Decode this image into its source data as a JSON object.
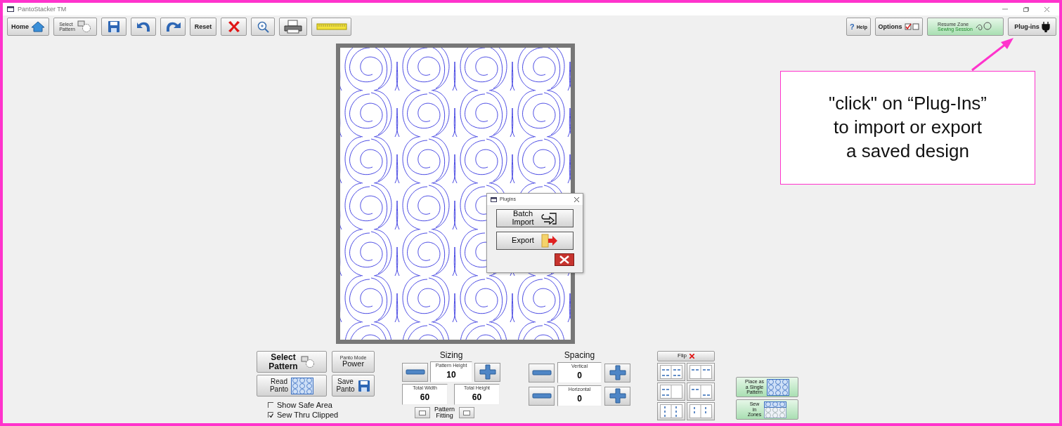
{
  "window": {
    "title": "PantoStacker TM"
  },
  "toolbar": [
    {
      "kind": "home",
      "label": "Home"
    },
    {
      "kind": "select",
      "lines": [
        "Select",
        "Pattern"
      ]
    },
    {
      "kind": "save"
    },
    {
      "kind": "undo"
    },
    {
      "kind": "redo"
    },
    {
      "kind": "reset",
      "label": "Reset"
    },
    {
      "kind": "delete"
    },
    {
      "kind": "zoom"
    },
    {
      "kind": "print"
    },
    {
      "kind": "ruler"
    }
  ],
  "toolbar_right": [
    {
      "kind": "help",
      "mark": "?",
      "label": "Help"
    },
    {
      "kind": "options",
      "label": "Options"
    },
    {
      "kind": "resume",
      "lines": [
        "Resume Zone",
        "Sewing Session"
      ]
    },
    {
      "kind": "plugins",
      "label": "Plug-ins"
    }
  ],
  "plugins_dialog": {
    "title": "Plugins",
    "buttons": [
      {
        "kind": "import",
        "lines": [
          "Batch",
          "Import"
        ]
      },
      {
        "kind": "export",
        "lines": [
          "Export"
        ]
      }
    ]
  },
  "mode_buttons": [
    {
      "kind": "select",
      "lines": [
        "Select",
        "Pattern"
      ]
    },
    {
      "kind": "mode",
      "caption": "Panto Mode",
      "lines": [
        "Power"
      ]
    },
    {
      "kind": "read",
      "lines": [
        "Read",
        "Panto"
      ]
    },
    {
      "kind": "save",
      "lines": [
        "Save",
        "Panto"
      ]
    }
  ],
  "checkboxes": [
    {
      "label": "Show Safe Area",
      "checked": false
    },
    {
      "label": "Sew Thru Clipped",
      "checked": true
    }
  ],
  "sizing": {
    "title": "Sizing",
    "pattern_height": {
      "label": "Pattern Height",
      "value": "10"
    },
    "total_width": {
      "label": "Total Width",
      "value": "60"
    },
    "total_height": {
      "label": "Total Height",
      "value": "60"
    },
    "fitting_lines": [
      "Pattern",
      "Fitting"
    ]
  },
  "spacing": {
    "title": "Spacing",
    "fields": [
      {
        "label": "Vertical",
        "value": "0"
      },
      {
        "label": "Horizontal",
        "value": "0"
      }
    ]
  },
  "flip": {
    "label": "Flip",
    "layouts": [
      {
        "kind": "grid"
      },
      {
        "kind": "split"
      },
      {
        "kind": "left"
      },
      {
        "kind": "diagonal"
      },
      {
        "kind": "columns"
      },
      {
        "kind": "halves"
      }
    ]
  },
  "placement": [
    {
      "kind": "single",
      "lines": [
        "Place as",
        "a Single",
        "Pattern"
      ]
    },
    {
      "kind": "zones",
      "lines": [
        "Sew",
        "in",
        "Zones"
      ]
    }
  ],
  "callout": {
    "lines": [
      "\"click\" on “Plug-Ins”",
      "to import or export",
      "a saved design"
    ]
  }
}
